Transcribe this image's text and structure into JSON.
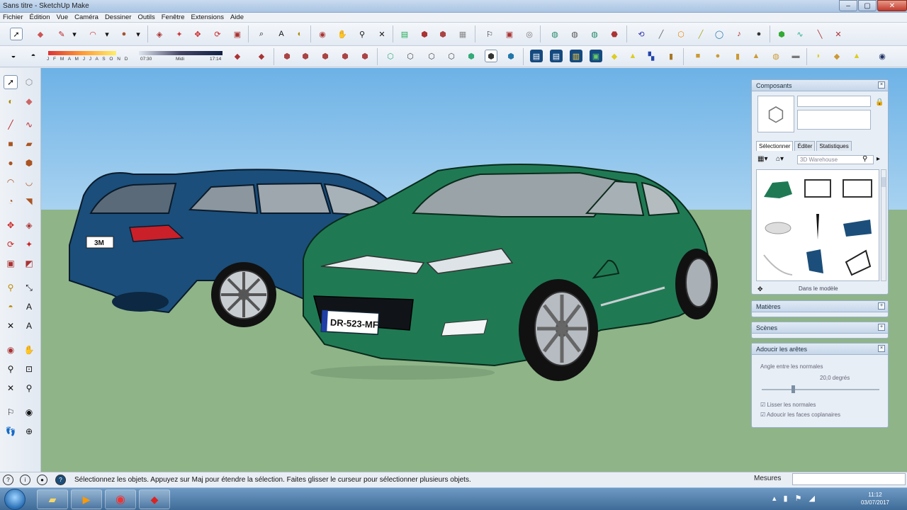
{
  "window": {
    "title": "Sans titre - SketchUp Make",
    "buttons": {
      "minimize": "–",
      "maximize": "▢",
      "close": "✕"
    }
  },
  "menu": [
    "Fichier",
    "Édition",
    "Vue",
    "Caméra",
    "Dessiner",
    "Outils",
    "Fenêtre",
    "Extensions",
    "Aide"
  ],
  "shadows": {
    "months": "J F M A M J J A S O N D",
    "time_start": "07:30",
    "time_mid": "Midi",
    "time_end": "17:14"
  },
  "scene": {
    "plate_blue": "3M",
    "plate_green": "DR-523-MF"
  },
  "components": {
    "title": "Composants",
    "tabs": [
      "Sélectionner",
      "Éditer",
      "Statistiques"
    ],
    "search_placeholder": "3D Warehouse",
    "footer": "Dans le modèle"
  },
  "materials": {
    "title": "Matières"
  },
  "scenes": {
    "title": "Scènes"
  },
  "soften": {
    "title": "Adoucir les arêtes",
    "label": "Angle entre les normales",
    "value": "20,0 degrés",
    "checkbox1": "Lisser les normales",
    "checkbox2": "Adoucir les faces coplanaires"
  },
  "status": {
    "message": "Sélectionnez les objets. Appuyez sur Maj pour étendre la sélection. Faites glisser le curseur pour sélectionner plusieurs objets.",
    "measures_label": "Mesures"
  },
  "clock": {
    "time": "11:12",
    "date": "03/07/2017"
  },
  "colors": {
    "sky": "#6db2e6",
    "ground": "#8fb488",
    "car_blue": "#1b4e7a",
    "car_green": "#1f7a54",
    "accent": "#3f6b98"
  }
}
